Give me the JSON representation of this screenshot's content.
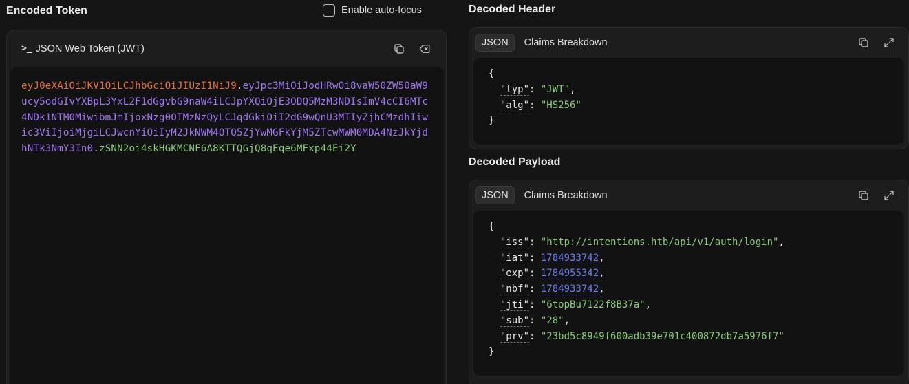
{
  "encoded": {
    "title": "Encoded Token",
    "autofocus_label": "Enable auto-focus",
    "card_title": "JSON Web Token (JWT)",
    "token_header": "eyJ0eXAiOiJKV1QiLCJhbGciOiJIUzI1NiJ9",
    "token_payload": "eyJpc3MiOiJodHRwOi8vaW50ZW50aW9ucy5odGIvYXBpL3YxL2F1dGgvbG9naW4iLCJpYXQiOjE3ODQ5MzM3NDIsImV4cCI6MTc4NDk1NTM0MiwibmJmIjoxNzg0OTMzNzQyLCJqdGkiOiI2dG9wQnU3MTIyZjhCMzdhIiwic3ViIjoiMjgiLCJwcnYiOiIyM2JkNWM4OTQ5ZjYwMGFkYjM5ZTcwMWM0MDA4NzJkYjdhNTk3NmY3In0",
    "token_signature": "zSNN2oi4skHGKMCNF6A8KTTQGjQ8qEqe6MFxp44Ei2Y"
  },
  "decoded_header": {
    "title": "Decoded Header",
    "tab_json": "JSON",
    "tab_claims": "Claims Breakdown",
    "open": "{",
    "close": "}",
    "fields": [
      {
        "key": "\"typ\"",
        "value": "\"JWT\"",
        "comma": ","
      },
      {
        "key": "\"alg\"",
        "value": "\"HS256\"",
        "comma": ""
      }
    ]
  },
  "decoded_payload": {
    "title": "Decoded Payload",
    "tab_json": "JSON",
    "tab_claims": "Claims Breakdown",
    "open": "{",
    "close": "}",
    "fields": [
      {
        "key": "\"iss\"",
        "value": "\"http://intentions.htb/api/v1/auth/login\"",
        "comma": ",",
        "type": "str"
      },
      {
        "key": "\"iat\"",
        "value": "1784933742",
        "comma": ",",
        "type": "num"
      },
      {
        "key": "\"exp\"",
        "value": "1784955342",
        "comma": ",",
        "type": "num"
      },
      {
        "key": "\"nbf\"",
        "value": "1784933742",
        "comma": ",",
        "type": "num"
      },
      {
        "key": "\"jti\"",
        "value": "\"6topBu7122f8B37a\"",
        "comma": ",",
        "type": "str"
      },
      {
        "key": "\"sub\"",
        "value": "\"28\"",
        "comma": ",",
        "type": "str"
      },
      {
        "key": "\"prv\"",
        "value": "\"23bd5c8949f600adb39e701c400872db7a5976f7\"",
        "comma": "",
        "type": "str"
      }
    ]
  },
  "icons": {
    "copy": "copy-icon",
    "clear": "clear-icon",
    "expand": "expand-icon",
    "prompt": "terminal-prompt-icon"
  },
  "colors": {
    "background": "#151515",
    "token_header": "#e96d3e",
    "token_payload": "#a176f2",
    "token_signature": "#8bcb7a",
    "json_string": "#8bcb7a",
    "json_number": "#6d7cf0"
  }
}
